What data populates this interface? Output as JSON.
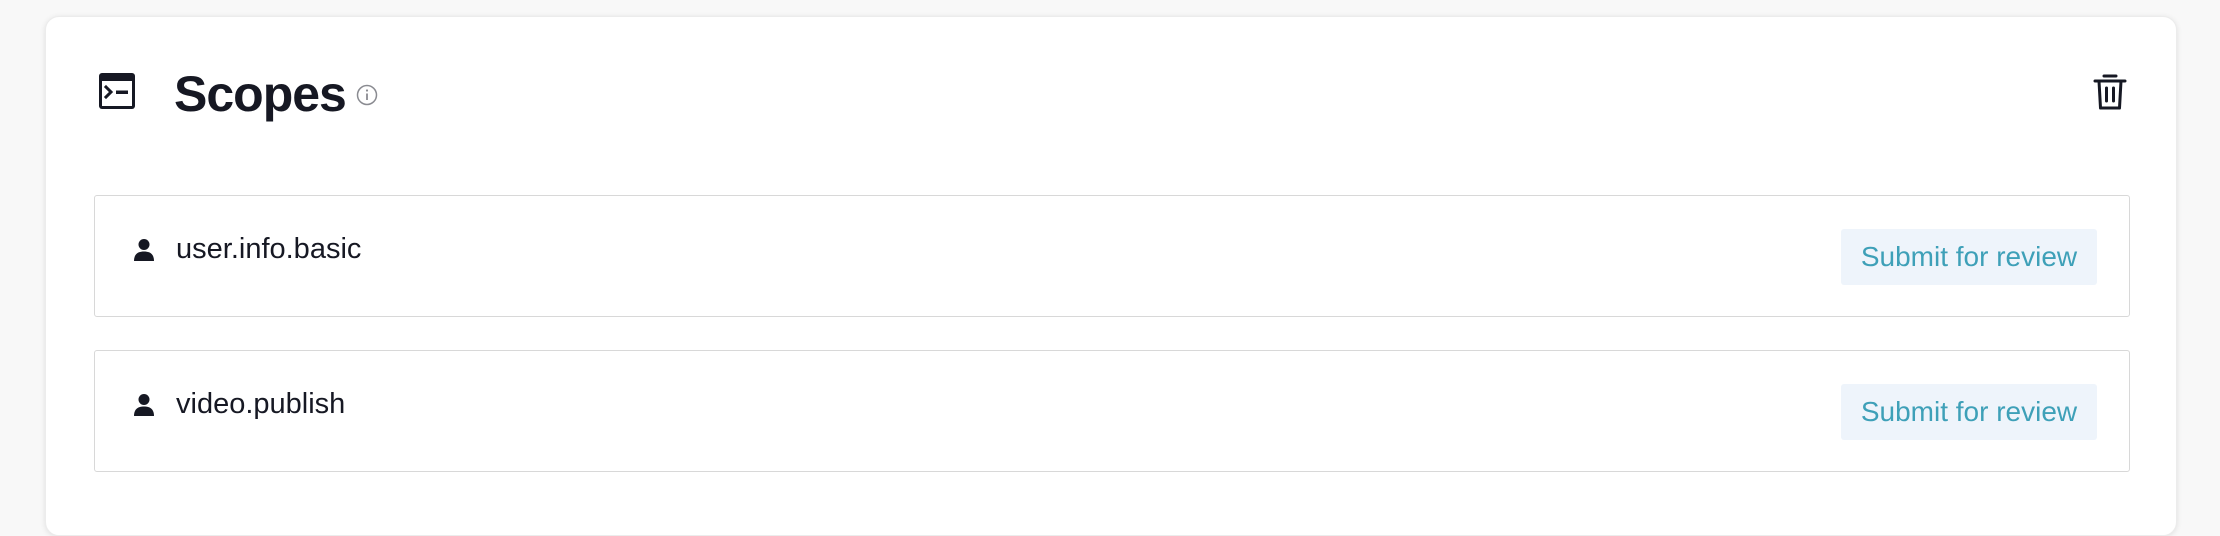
{
  "header": {
    "title": "Scopes",
    "header_icon": "terminal-window-icon",
    "info_icon": "info-circle-icon",
    "delete_icon": "trash-icon"
  },
  "scopes": [
    {
      "name": "user.info.basic",
      "icon": "user-icon",
      "action_label": "Submit for review"
    },
    {
      "name": "video.publish",
      "icon": "user-icon",
      "action_label": "Submit for review"
    }
  ],
  "colors": {
    "accent_text": "#3ea0b8",
    "button_bg": "#eef4fb",
    "text": "#161823",
    "border": "#d8d8d8"
  }
}
